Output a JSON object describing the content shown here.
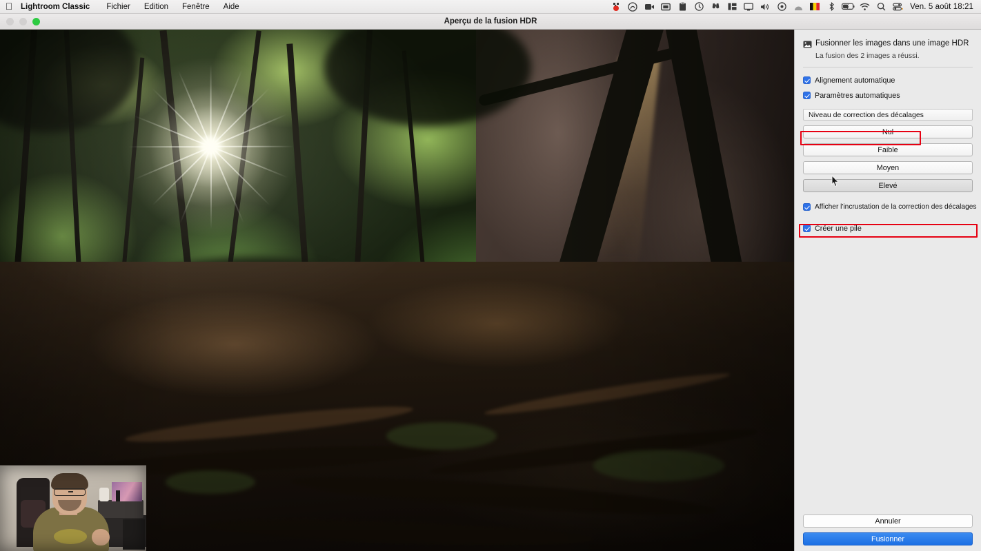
{
  "menubar": {
    "apple_icon": "apple-logo",
    "items": [
      {
        "label": "Lightroom Classic",
        "bold": true
      },
      {
        "label": "Fichier",
        "bold": false
      },
      {
        "label": "Edition",
        "bold": false
      },
      {
        "label": "Fenêtre",
        "bold": false
      },
      {
        "label": "Aide",
        "bold": false
      }
    ],
    "status_icons": [
      "screen-record-red-icon",
      "creative-cloud-icon",
      "video-camera-icon",
      "display-mirror-icon",
      "clipboard-icon",
      "clock-icon",
      "binoculars-icon",
      "split-panel-icon",
      "monitor-icon",
      "volume-icon",
      "record-dot-icon",
      "arc-browser-icon",
      "belgium-flag-icon",
      "bluetooth-icon",
      "battery-icon",
      "wifi-icon",
      "search-icon",
      "control-center-icon"
    ],
    "clock": "Ven. 5 août  18:21"
  },
  "window": {
    "title": "Aperçu de la fusion HDR",
    "traffic_lights": [
      "close",
      "minimize",
      "zoom"
    ]
  },
  "panel": {
    "header_icon": "hdr-photo-icon",
    "title": "Fusionner les images dans une image HDR",
    "subtitle": "La fusion des 2 images a réussi.",
    "checkboxes_top": [
      {
        "label": "Alignement automatique",
        "checked": true
      },
      {
        "label": "Paramètres automatiques",
        "checked": true
      }
    ],
    "section_label": "Niveau de correction des décalages",
    "level_buttons": [
      {
        "label": "Nul",
        "active": false
      },
      {
        "label": "Faible",
        "active": false
      },
      {
        "label": "Moyen",
        "active": false
      },
      {
        "label": "Elevé",
        "active": true
      }
    ],
    "overlay_checkbox": {
      "label": "Afficher l'incrustation de la correction des décalages",
      "checked": true
    },
    "stack_checkbox": {
      "label": "Créer une pile",
      "checked": true
    },
    "cancel_label": "Annuler",
    "merge_label": "Fusionner",
    "annotation_color": "#e60012",
    "accent_color": "#2f72e8",
    "panel_bg": "#eaeaea"
  },
  "preview": {
    "description": "Photo de forêt avec rayons de soleil à travers la canopée et falaise rocheuse",
    "webcam_overlay": "webcam-presenter-overlay"
  }
}
